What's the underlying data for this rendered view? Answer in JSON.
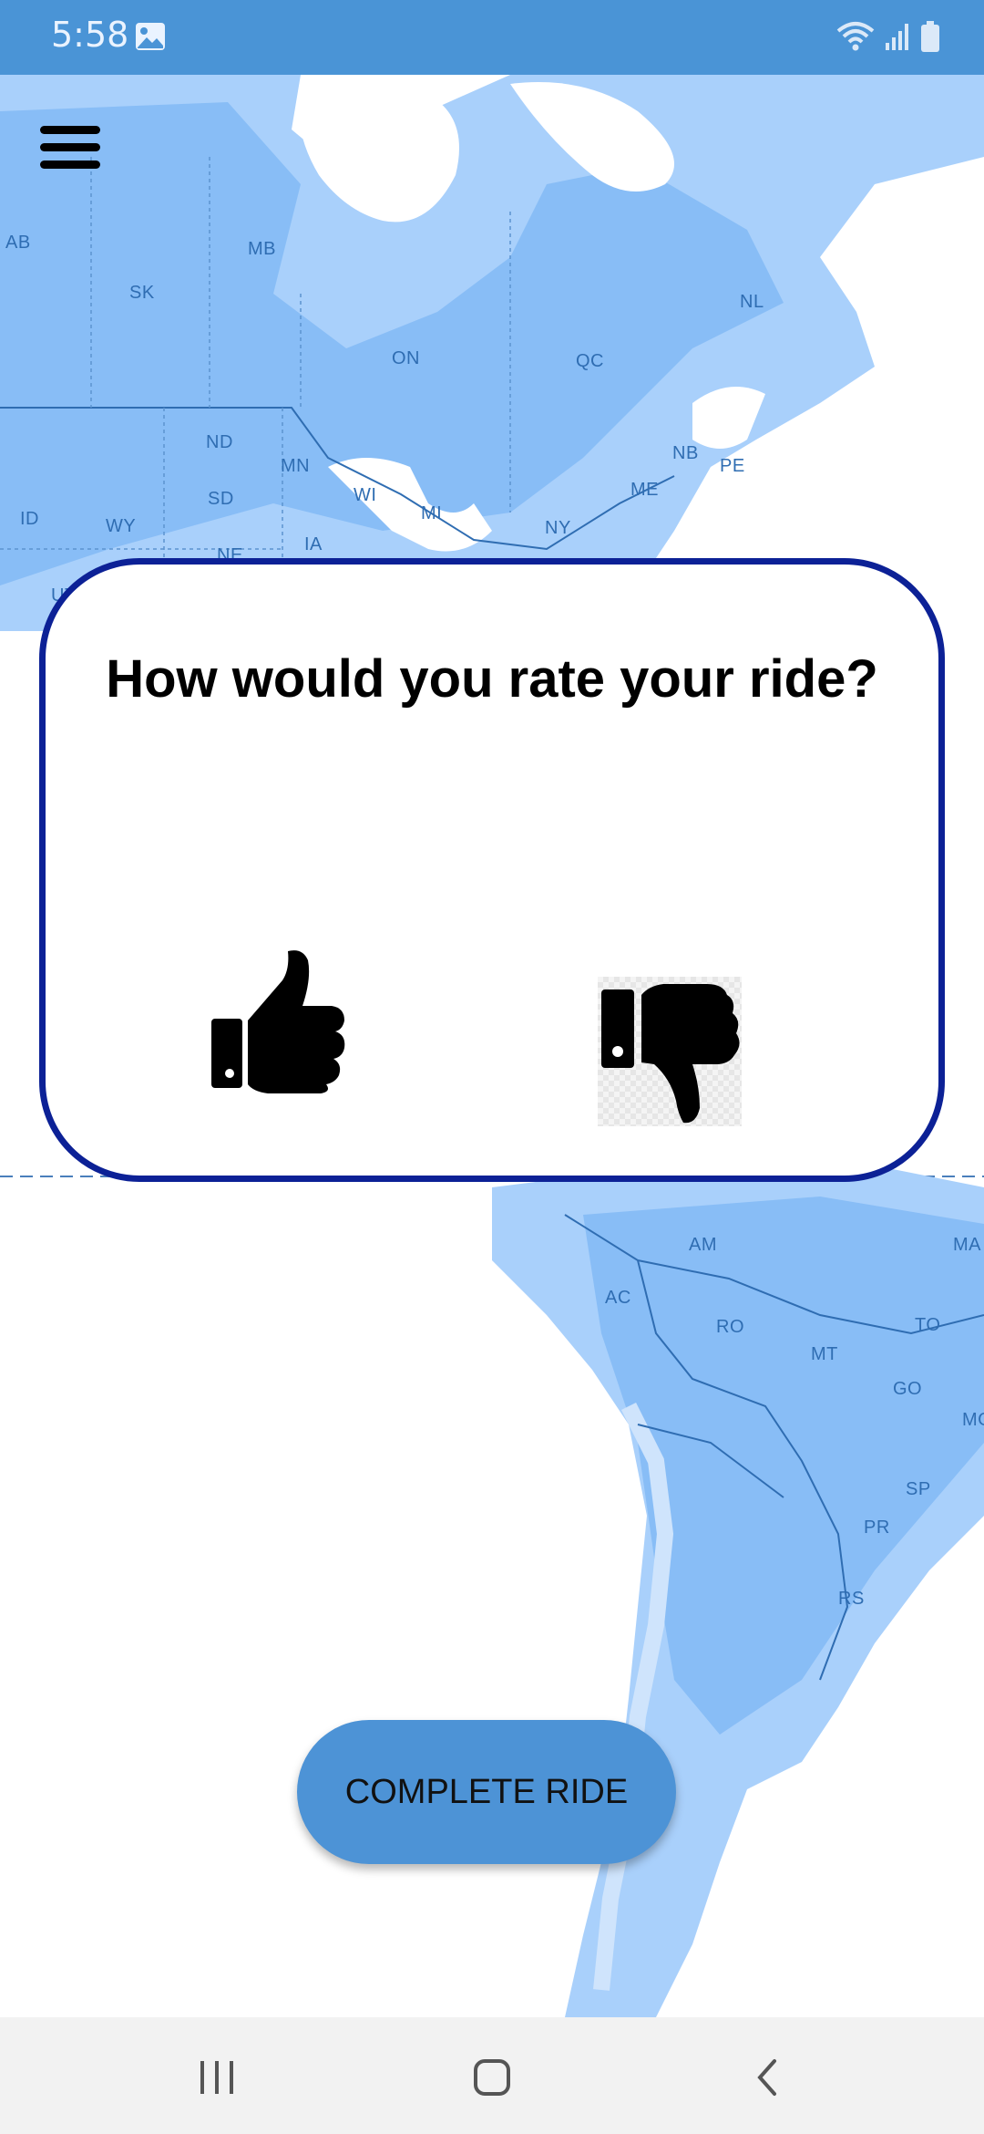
{
  "status_bar": {
    "time": "5:58",
    "icons": [
      "image-icon",
      "wifi-icon",
      "signal-icon",
      "battery-icon"
    ]
  },
  "map": {
    "labels": {
      "ab": "AB",
      "mb": "MB",
      "sk": "SK",
      "on": "ON",
      "qc": "QC",
      "nl": "NL",
      "nd": "ND",
      "mn": "MN",
      "sd": "SD",
      "wi": "WI",
      "mi": "MI",
      "ny": "NY",
      "me": "ME",
      "nb": "NB",
      "pe": "PE",
      "id": "ID",
      "wy": "WY",
      "ne": "NE",
      "ia": "IA",
      "ut": "UT",
      "am": "AM",
      "ma": "MA",
      "ac": "AC",
      "ro": "RO",
      "to": "TO",
      "mt": "MT",
      "go": "GO",
      "mg": "MG",
      "sp": "SP",
      "pr": "PR",
      "rs": "RS"
    }
  },
  "menu": {
    "icon": "hamburger-menu-icon"
  },
  "rating_dialog": {
    "title": "How would you rate your ride?",
    "thumbs_up_icon": "thumbs-up-icon",
    "thumbs_down_icon": "thumbs-down-icon"
  },
  "complete_button": {
    "label": "COMPLETE RIDE"
  },
  "nav_bar": {
    "icons": [
      "recent-apps-icon",
      "home-icon",
      "back-icon"
    ]
  },
  "colors": {
    "status_bar": "#4a94d6",
    "dialog_border": "#0c2196",
    "button": "#4d93d6",
    "map_land": "#a9d0fb"
  }
}
